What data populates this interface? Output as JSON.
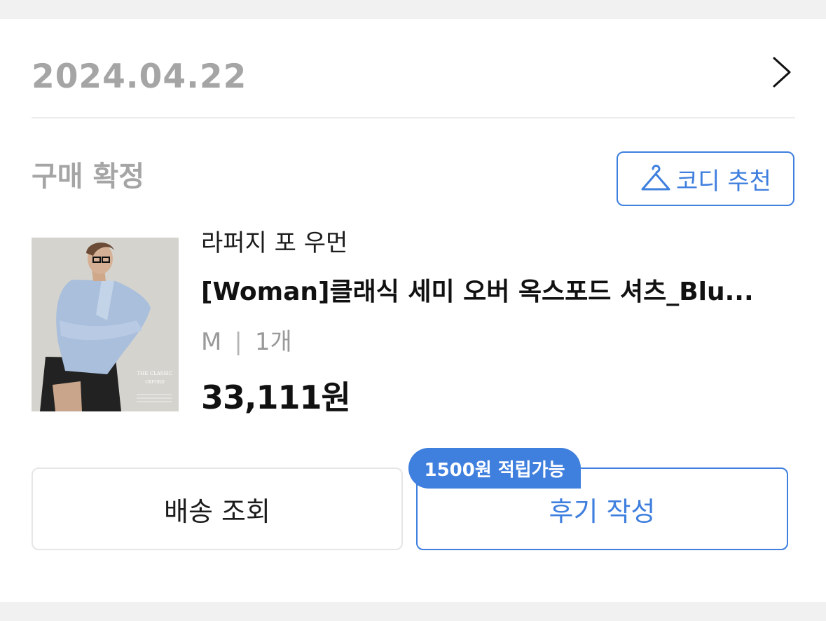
{
  "order": {
    "date": "2024.04.22",
    "status": "구매 확정"
  },
  "codi_button": {
    "label": "코디 추천",
    "icon": "hanger-icon"
  },
  "product": {
    "brand": "라퍼지 포 우먼",
    "name": "[Woman]클래식 세미 오버 옥스포드 셔츠_Blu...",
    "option_size": "M",
    "option_separator": "|",
    "option_qty": "1개",
    "price": "33,111원",
    "image_caption_1": "THE CLASSIC",
    "image_caption_2": "OXFORD"
  },
  "actions": {
    "shipping_label": "배송 조회",
    "review_label": "후기 작성",
    "review_badge": "1500원 적립가능"
  },
  "colors": {
    "accent": "#3f7fde",
    "muted": "#a5a5a5"
  }
}
